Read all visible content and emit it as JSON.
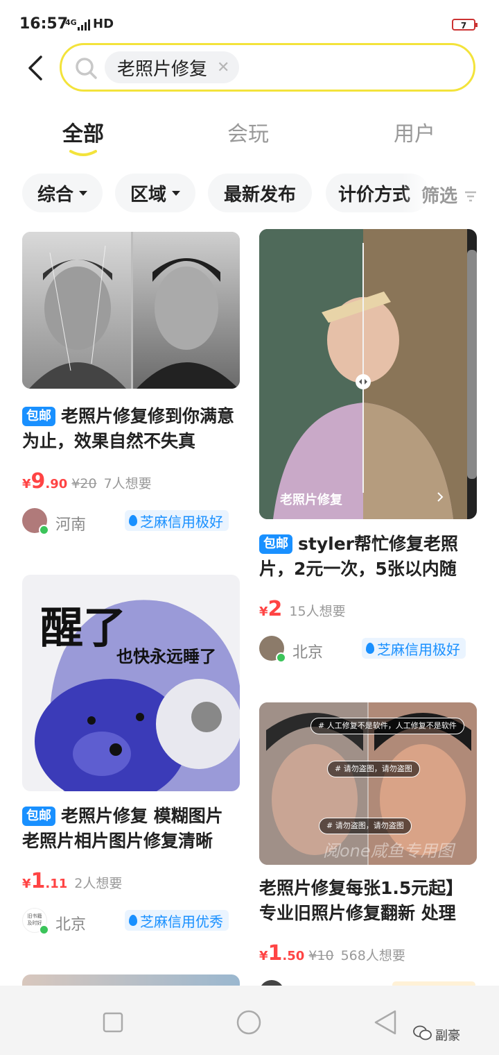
{
  "status_bar": {
    "time": "16:57",
    "network": "4G",
    "hd": "HD",
    "battery": "7"
  },
  "search": {
    "query": "老照片修复"
  },
  "tabs": [
    {
      "label": "全部",
      "active": true
    },
    {
      "label": "会玩",
      "active": false
    },
    {
      "label": "用户",
      "active": false
    }
  ],
  "filters": {
    "items": [
      "综合",
      "区域",
      "最新发布",
      "计价方式"
    ],
    "sift": "筛选"
  },
  "listings": [
    {
      "badge": "包邮",
      "title": "老照片修复修到你满意为止，效果自然不失真",
      "yen": "¥",
      "price_int": "9",
      "price_dec": ".90",
      "original": "¥20",
      "wants": "7人想要",
      "location": "河南",
      "credit": "芝麻信用极好"
    },
    {
      "badge": "包邮",
      "title": "styler帮忙修复老照片，2元一次，5张以内随",
      "image_caption": "老照片修复",
      "yen": "¥",
      "price_int": "2",
      "price_dec": "",
      "wants": "15人想要",
      "location": "北京",
      "credit": "芝麻信用极好"
    },
    {
      "badge": "包邮",
      "title": "老照片修复 模糊图片老照片相片图片修复清晰",
      "image_text_main": "醒了",
      "image_text_sub": "也快永远睡了",
      "yen": "¥",
      "price_int": "1",
      "price_dec": ".11",
      "wants": "2人想要",
      "location": "北京",
      "credit": "芝麻信用优秀",
      "avatar_text_1": "旧书籍",
      "avatar_text_2": "及时好"
    },
    {
      "title": "老照片修复每张1.5元起】专业旧照片修复翻新 处理",
      "image_tags": [
        "# 人工修复不是软件，人工修复不是软件",
        "# 请勿盗图，请勿盗图",
        "# 请勿盗图，请勿盗图"
      ],
      "image_watermark": "阅one咸鱼专用图",
      "yen": "¥",
      "price_int": "1",
      "price_dec": ".50",
      "original": "¥10",
      "wants": "568人想要"
    }
  ],
  "watermark": "副豪",
  "colors": {
    "accent_yellow": "#f3e33b",
    "price_red": "#ff4444",
    "badge_blue": "#1990ff",
    "online_green": "#3bc45a"
  }
}
